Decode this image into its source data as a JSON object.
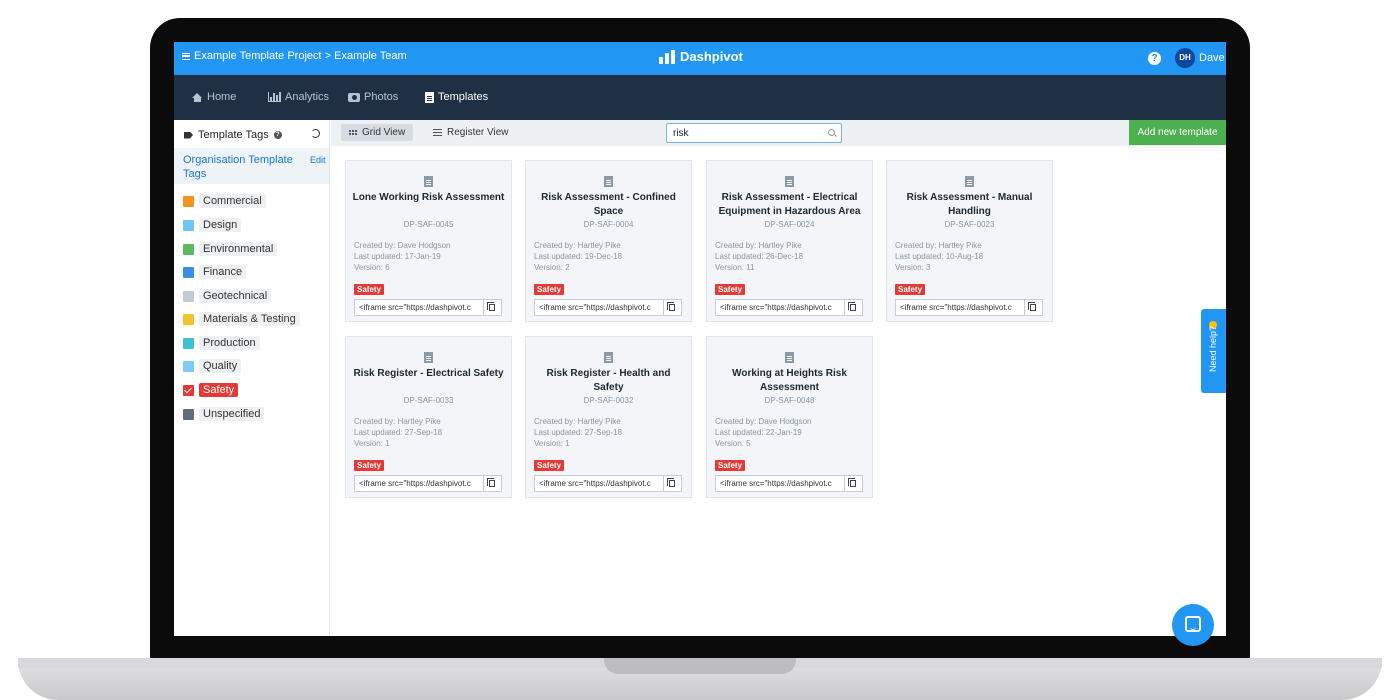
{
  "header": {
    "breadcrumb": "Example Template Project > Example Team",
    "brand": "Dashpivot",
    "help_glyph": "?",
    "user_initials": "DH",
    "user_name": "Dave",
    "brand_color": "#2196f3"
  },
  "nav": {
    "items": [
      {
        "label": "Home",
        "icon": "home-icon"
      },
      {
        "label": "Analytics",
        "icon": "bar-chart-icon"
      },
      {
        "label": "Photos",
        "icon": "camera-icon"
      },
      {
        "label": "Templates",
        "icon": "document-icon",
        "active": true
      }
    ]
  },
  "sidebar": {
    "title": "Template Tags",
    "org_tags_label": "Organisation Template Tags",
    "edit_label": "Edit",
    "tags": [
      {
        "label": "Commercial",
        "color": "#f7941d"
      },
      {
        "label": "Design",
        "color": "#6ec6f5"
      },
      {
        "label": "Environmental",
        "color": "#5cb85c"
      },
      {
        "label": "Finance",
        "color": "#3a8ee6"
      },
      {
        "label": "Geotechnical",
        "color": "#c3cbd3"
      },
      {
        "label": "Materials & Testing",
        "color": "#f2c12e"
      },
      {
        "label": "Production",
        "color": "#3fc1d0"
      },
      {
        "label": "Quality",
        "color": "#7fc8f8"
      },
      {
        "label": "Safety",
        "color": "#e53935",
        "selected": true
      },
      {
        "label": "Unspecified",
        "color": "#5e6c7b"
      }
    ]
  },
  "toolbar": {
    "grid_view_label": "Grid View",
    "register_view_label": "Register View",
    "search_value": "risk",
    "add_template_label": "Add new template"
  },
  "cards": [
    {
      "title": "Lone Working Risk Assessment",
      "code": "DP-SAF-0045",
      "created_by": "Created by: Dave Hodgson",
      "last_updated": "Last updated: 17-Jan-19",
      "version": "Version: 6",
      "badge": "Safety",
      "embed": "<iframe src=\"https://dashpivot.c"
    },
    {
      "title": "Risk Assessment - Confined Space",
      "code": "DP-SAF-0004",
      "created_by": "Created by: Hartley Pike",
      "last_updated": "Last updated: 19-Dec-18",
      "version": "Version: 2",
      "badge": "Safety",
      "embed": "<iframe src=\"https://dashpivot.c"
    },
    {
      "title": "Risk Assessment - Electrical Equipment in Hazardous Area",
      "code": "DP-SAF-0024",
      "created_by": "Created by: Hartley Pike",
      "last_updated": "Last updated: 26-Dec-18",
      "version": "Version: 11",
      "badge": "Safety",
      "embed": "<iframe src=\"https://dashpivot.c"
    },
    {
      "title": "Risk Assessment - Manual Handling",
      "code": "DP-SAF-0023",
      "created_by": "Created by: Hartley Pike",
      "last_updated": "Last updated: 10-Aug-18",
      "version": "Version: 3",
      "badge": "Safety",
      "embed": "<iframe src=\"https://dashpivot.c"
    },
    {
      "title": "Risk Register - Electrical Safety",
      "code": "DP-SAF-0033",
      "created_by": "Created by: Hartley Pike",
      "last_updated": "Last updated: 27-Sep-18",
      "version": "Version: 1",
      "badge": "Safety",
      "embed": "<iframe src=\"https://dashpivot.c"
    },
    {
      "title": "Risk Register - Health and Safety",
      "code": "DP-SAF-0032",
      "created_by": "Created by: Hartley Pike",
      "last_updated": "Last updated: 27-Sep-18",
      "version": "Version: 1",
      "badge": "Safety",
      "embed": "<iframe src=\"https://dashpivot.c"
    },
    {
      "title": "Working at Heights Risk Assessment",
      "code": "DP-SAF-0048",
      "created_by": "Created by: Dave Hodgson",
      "last_updated": "Last updated: 22-Jan-19",
      "version": "Version: 5",
      "badge": "Safety",
      "embed": "<iframe src=\"https://dashpivot.c"
    }
  ],
  "help_tab": {
    "label": "Need help?"
  }
}
